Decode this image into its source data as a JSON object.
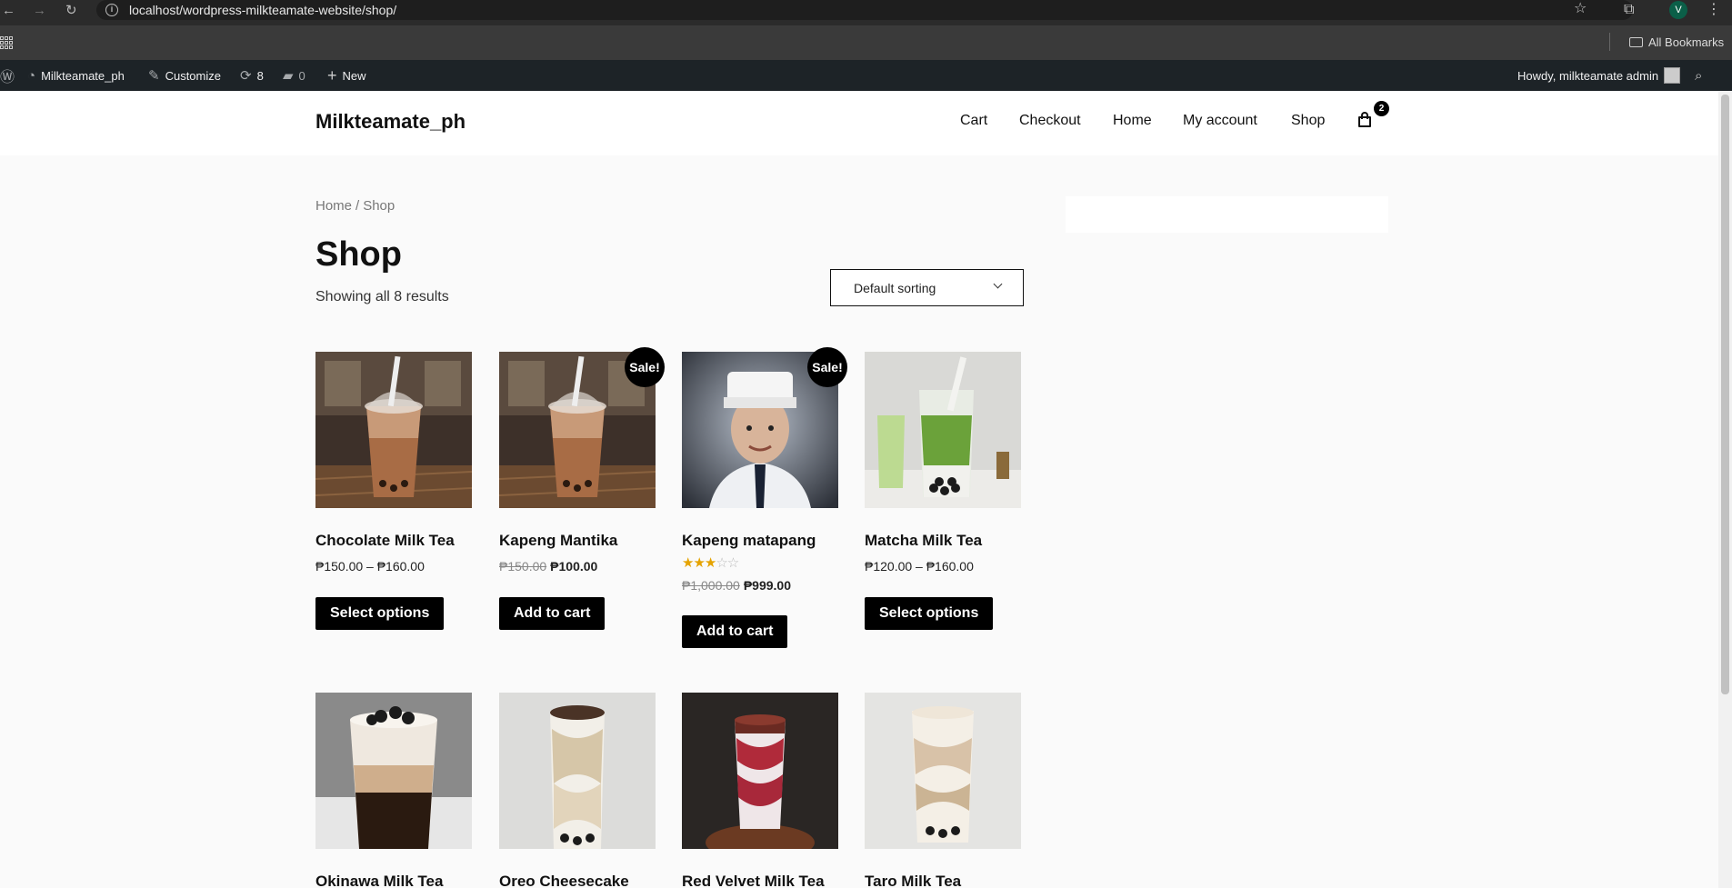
{
  "browser": {
    "url": "localhost/wordpress-milkteamate-website/shop/",
    "profile_initial": "V",
    "all_bookmarks_label": "All Bookmarks"
  },
  "admin_bar": {
    "site_name": "Milkteamate_ph",
    "customize_label": "Customize",
    "updates_count": "8",
    "comments_count": "0",
    "new_label": "New",
    "howdy_label": "Howdy, milkteamate admin"
  },
  "site": {
    "title": "Milkteamate_ph",
    "nav": [
      "Cart",
      "Checkout",
      "Home",
      "My account",
      "Shop"
    ],
    "cart_count": "2"
  },
  "breadcrumb": {
    "home": "Home",
    "separator": "/",
    "current": "Shop"
  },
  "page_title": "Shop",
  "results_text": "Showing all 8 results",
  "sorting": {
    "selected": "Default sorting"
  },
  "products": [
    {
      "name": "Chocolate Milk Tea",
      "price_range": "₱150.00 – ₱160.00",
      "button": "Select options",
      "sale": false,
      "theme": "chocolate"
    },
    {
      "name": "Kapeng Mantika",
      "price_old": "₱150.00",
      "price_new": "₱100.00",
      "button": "Add to cart",
      "sale": true,
      "sale_label": "Sale!",
      "theme": "chocolate"
    },
    {
      "name": "Kapeng matapang",
      "rating": 3,
      "price_old": "₱1,000.00",
      "price_new": "₱999.00",
      "button": "Add to cart",
      "sale": true,
      "sale_label": "Sale!",
      "theme": "portrait"
    },
    {
      "name": "Matcha Milk Tea",
      "price_range": "₱120.00 – ₱160.00",
      "button": "Select options",
      "sale": false,
      "theme": "matcha"
    },
    {
      "name": "Okinawa Milk Tea",
      "theme": "okinawa"
    },
    {
      "name": "Oreo Cheesecake",
      "theme": "oreo"
    },
    {
      "name": "Red Velvet Milk Tea",
      "theme": "redvelvet"
    },
    {
      "name": "Taro Milk Tea",
      "theme": "taro"
    }
  ]
}
